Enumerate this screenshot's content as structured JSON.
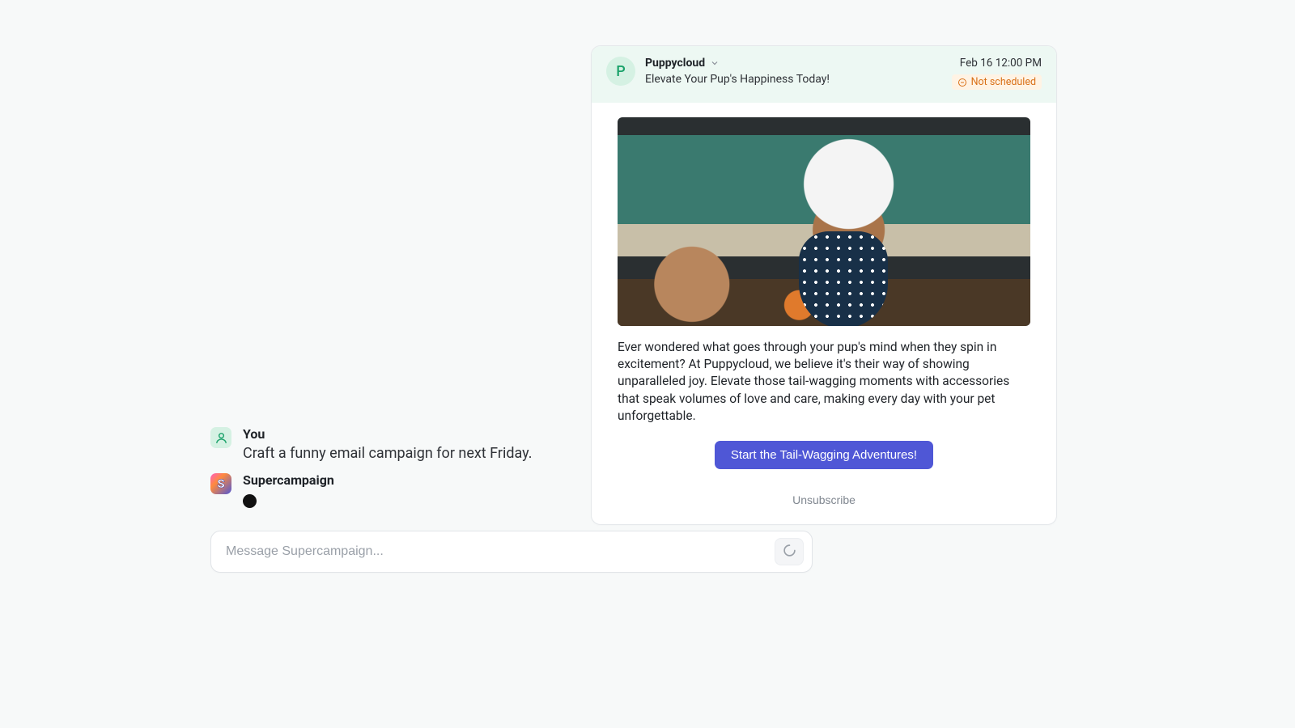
{
  "preview": {
    "avatarInitial": "P",
    "sender": "Puppycloud",
    "subject": "Elevate Your Pup's Happiness Today!",
    "timestamp": "Feb 16 12:00 PM",
    "status": "Not scheduled",
    "body": "Ever wondered what goes through your pup's mind when they spin in excitement? At Puppycloud, we believe it's their way of showing unparalleled joy. Elevate those tail-wagging moments with accessories that speak volumes of love and care, making every day with your pet unforgettable.",
    "cta": "Start the Tail-Wagging Adventures!",
    "unsubscribe": "Unsubscribe",
    "heroAlt": "Dog wearing a chef hat and polka-dot apron in a kitchen"
  },
  "chat": {
    "user": {
      "name": "You",
      "text": "Craft a funny email campaign for next Friday."
    },
    "assistant": {
      "name": "Supercampaign"
    }
  },
  "composer": {
    "placeholder": "Message Supercampaign..."
  }
}
